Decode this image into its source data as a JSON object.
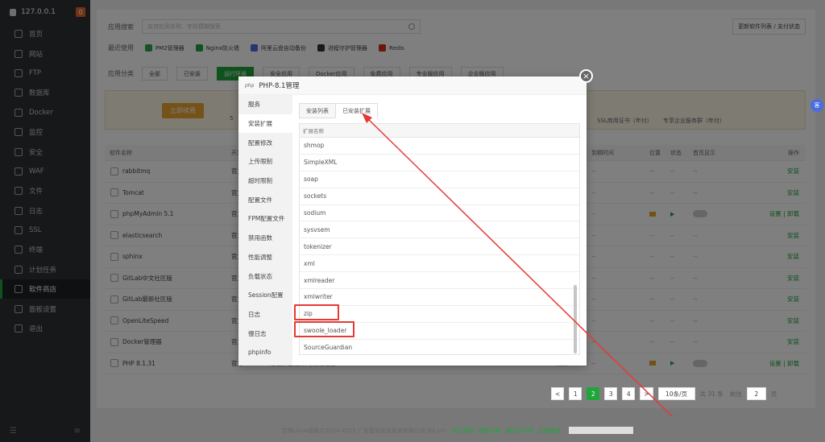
{
  "sidebar": {
    "host": "127.0.0.1",
    "badge": "0",
    "items": [
      {
        "label": "首页",
        "icon": "home-icon"
      },
      {
        "label": "网站",
        "icon": "globe-icon"
      },
      {
        "label": "FTP",
        "icon": "ftp-icon"
      },
      {
        "label": "数据库",
        "icon": "database-icon"
      },
      {
        "label": "Docker",
        "icon": "docker-icon"
      },
      {
        "label": "监控",
        "icon": "monitor-icon"
      },
      {
        "label": "安全",
        "icon": "shield-icon"
      },
      {
        "label": "WAF",
        "icon": "waf-icon"
      },
      {
        "label": "文件",
        "icon": "folder-icon"
      },
      {
        "label": "日志",
        "icon": "log-icon"
      },
      {
        "label": "SSL",
        "icon": "ssl-icon"
      },
      {
        "label": "终端",
        "icon": "terminal-icon"
      },
      {
        "label": "计划任务",
        "icon": "clock-icon"
      },
      {
        "label": "软件商店",
        "icon": "store-icon"
      },
      {
        "label": "面板设置",
        "icon": "gear-icon"
      },
      {
        "label": "退出",
        "icon": "logout-icon"
      }
    ],
    "active_index": 13
  },
  "store": {
    "search_label": "应用搜索",
    "search_placeholder": "支持应用名称、字段模糊搜索",
    "update_button": "更新软件列表 / 支付状态",
    "recent_label": "最近使用",
    "recent": [
      {
        "label": "PM2管理器",
        "color": "#2ea44f"
      },
      {
        "label": "Nginx防火墙",
        "color": "#20a53a"
      },
      {
        "label": "阿里云盘自动备份",
        "color": "#4a6ee0"
      },
      {
        "label": "进程守护管理器",
        "color": "#333333"
      },
      {
        "label": "Redis",
        "color": "#d82c20"
      }
    ],
    "category_label": "应用分类",
    "categories": [
      "全部",
      "已安装",
      "运行环境",
      "安全应用",
      "Docker应用",
      "免费应用",
      "专业版应用",
      "企业版应用"
    ],
    "category_active": 2,
    "banner_cta": "立即续费",
    "banner_text_right_1": "SSL商用证书（年付）",
    "banner_text_right_2": "专享企业服务群（年付）",
    "banner_left_fragment": "5",
    "table_headers": {
      "name": "软件名称",
      "dev": "开发",
      "expire": "到期时间",
      "location": "位置",
      "status": "状态",
      "home_show": "首页显示",
      "ops": "操作"
    },
    "rows": [
      {
        "name": "rabbitmq",
        "src": "官方",
        "action": "安装",
        "expire": "--",
        "location": "--",
        "status": "--",
        "home_show": "--"
      },
      {
        "name": "Tomcat",
        "src": "官方",
        "action": "安装",
        "expire": "--",
        "location": "--",
        "status": "--",
        "home_show": "--"
      },
      {
        "name": "phpMyAdmin 5.1",
        "src": "官方",
        "action": "设置 | 卸载",
        "expire": "--",
        "location": "",
        "status": "",
        "home_show": ""
      },
      {
        "name": "elasticsearch",
        "src": "官方",
        "action": "安装",
        "expire": "--",
        "location": "--",
        "status": "--",
        "home_show": "--"
      },
      {
        "name": "sphinx",
        "src": "官方",
        "action": "安装",
        "expire": "--",
        "location": "--",
        "status": "--",
        "home_show": "--"
      },
      {
        "name": "GitLab中文社区版",
        "src": "官方",
        "action": "安装",
        "expire": "--",
        "location": "--",
        "status": "--",
        "home_show": "--"
      },
      {
        "name": "GitLab最新社区版",
        "src": "官方",
        "action": "安装",
        "expire": "--",
        "location": "--",
        "status": "--",
        "home_show": "--"
      },
      {
        "name": "OpenLiteSpeed",
        "src": "官方",
        "action": "安装",
        "expire": "--",
        "location": "--",
        "status": "--",
        "home_show": "--"
      },
      {
        "name": "Docker管理器",
        "src": "官方",
        "action": "安装",
        "expire": "--",
        "location": "--",
        "status": "--",
        "home_show": "--"
      },
      {
        "name": "PHP 8.1.31",
        "src": "官方",
        "desc": "PHP是世界上最好的编程语言",
        "price": "免费",
        "action": "设置 | 卸载",
        "expire": "--",
        "location": "",
        "status": "",
        "home_show": ""
      }
    ],
    "pager": {
      "prev": "<",
      "pages": [
        "1",
        "2",
        "3",
        "4"
      ],
      "current": "2",
      "next": ">",
      "per_page": "10条/页",
      "total": "共 31 条",
      "goto_label": "前往",
      "goto_value": "2",
      "page_suffix": "页"
    }
  },
  "modal": {
    "badge": "php",
    "title": "PHP-8.1管理",
    "close": "×",
    "nav": [
      "服务",
      "安装扩展",
      "配置修改",
      "上传限制",
      "超时限制",
      "配置文件",
      "FPM配置文件",
      "禁用函数",
      "性能调整",
      "负载状态",
      "Session配置",
      "日志",
      "慢日志",
      "phpinfo"
    ],
    "nav_active": 1,
    "tabs": [
      "安装列表",
      "已安装扩展"
    ],
    "tab_active": 1,
    "list_header": "扩展名称",
    "extensions": [
      "shmop",
      "SimpleXML",
      "soap",
      "sockets",
      "sodium",
      "sysvsem",
      "tokenizer",
      "xml",
      "xmlreader",
      "xmlwriter",
      "zip",
      "swoole_loader",
      "SourceGuardian"
    ],
    "highlighted": [
      "zip",
      "swoole_loader"
    ]
  },
  "footer": {
    "copyright": "宝塔Linux面板©2014-2025 广东堡塔安全技术有限公司 (bt.cn)",
    "links": [
      "论坛求助",
      "使用手册",
      "微信公众号",
      "正版查询"
    ]
  },
  "float_button": "客"
}
